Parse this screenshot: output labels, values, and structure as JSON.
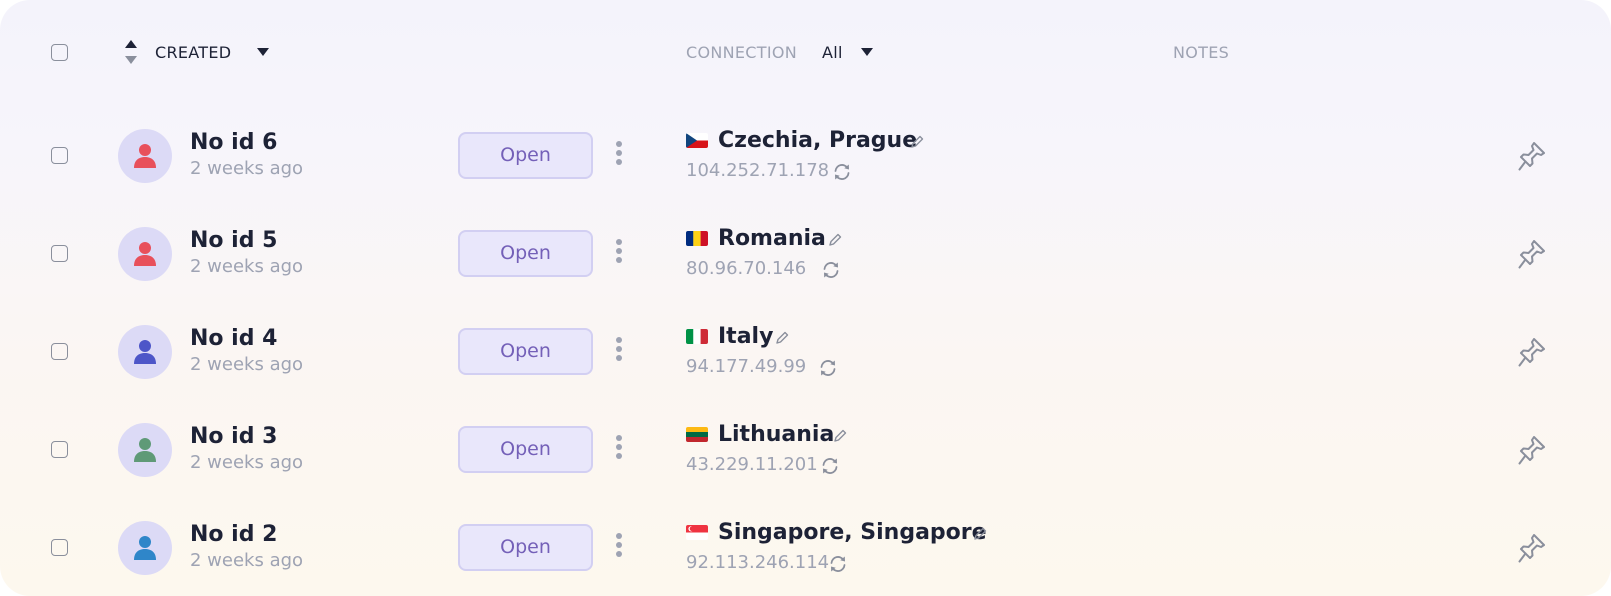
{
  "header": {
    "created_label": "CREATED",
    "connection_label": "CONNECTION",
    "connection_filter": "All",
    "notes_label": "NOTES"
  },
  "colors": {
    "accent": "#7460b8",
    "text_primary": "#1d2236",
    "text_muted": "#9ea3b3",
    "button_bg": "#e9e7fb",
    "avatar_bg": "#dcdaf6"
  },
  "rows": [
    {
      "name": "No id 6",
      "created": "2 weeks ago",
      "open_label": "Open",
      "avatar_color": "#e8505b",
      "flag": "cz",
      "location": "Czechia, Prague",
      "ip": "104.252.71.178"
    },
    {
      "name": "No id 5",
      "created": "2 weeks ago",
      "open_label": "Open",
      "avatar_color": "#e8505b",
      "flag": "ro",
      "location": "Romania",
      "ip": "80.96.70.146"
    },
    {
      "name": "No id 4",
      "created": "2 weeks ago",
      "open_label": "Open",
      "avatar_color": "#4d56c8",
      "flag": "it",
      "location": "Italy",
      "ip": "94.177.49.99"
    },
    {
      "name": "No id 3",
      "created": "2 weeks ago",
      "open_label": "Open",
      "avatar_color": "#5f9a77",
      "flag": "lt",
      "location": "Lithuania",
      "ip": "43.229.11.201"
    },
    {
      "name": "No id 2",
      "created": "2 weeks ago",
      "open_label": "Open",
      "avatar_color": "#2f86c9",
      "flag": "sg",
      "location": "Singapore, Singapore",
      "ip": "92.113.246.114"
    }
  ]
}
